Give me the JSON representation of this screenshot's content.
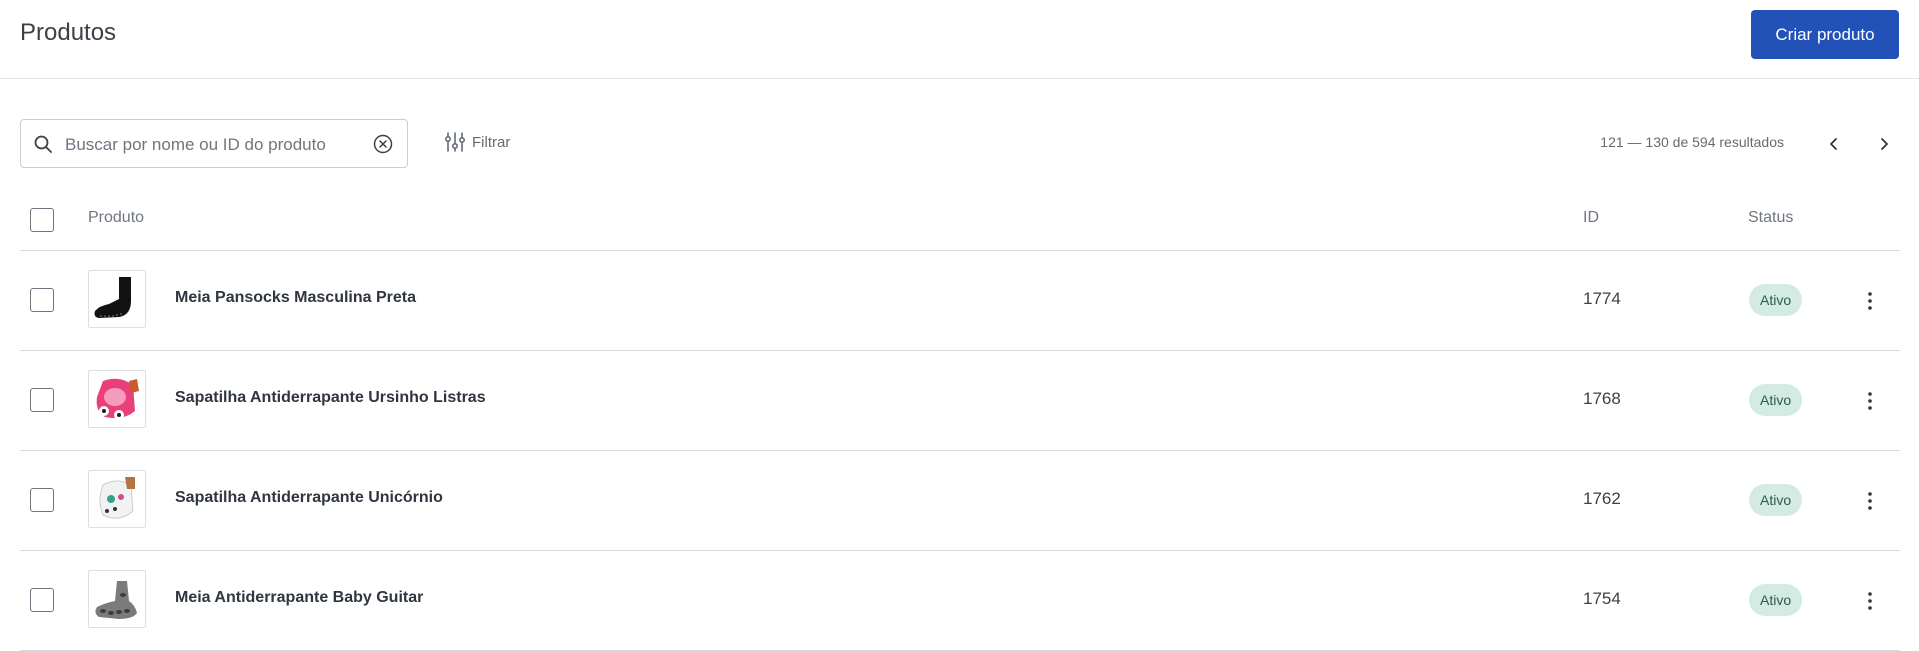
{
  "header": {
    "title": "Produtos",
    "create_label": "Criar produto"
  },
  "toolbar": {
    "search_placeholder": "Buscar por nome ou ID do produto",
    "search_value": "",
    "filter_label": "Filtrar",
    "results_text": "121 — 130 de 594 resultados"
  },
  "table": {
    "headers": {
      "product": "Produto",
      "id": "ID",
      "status": "Status"
    },
    "rows": [
      {
        "name": "Meia Pansocks Masculina Preta",
        "id": "1774",
        "status": "Ativo",
        "thumb": "black-sock"
      },
      {
        "name": "Sapatilha Antiderrapante Ursinho Listras",
        "id": "1768",
        "status": "Ativo",
        "thumb": "pink-slipper"
      },
      {
        "name": "Sapatilha Antiderrapante Unicórnio",
        "id": "1762",
        "status": "Ativo",
        "thumb": "unicorn-slipper"
      },
      {
        "name": "Meia Antiderrapante Baby Guitar",
        "id": "1754",
        "status": "Ativo",
        "thumb": "gray-sock"
      }
    ]
  },
  "colors": {
    "primary": "#2251b8",
    "badge_bg": "#d3ebe2",
    "badge_text": "#2d5b4a",
    "border": "#d6d9dd"
  },
  "icons": [
    "search-icon",
    "clear-circle-x-icon",
    "filter-sliders-icon",
    "chevron-left-icon",
    "chevron-right-icon",
    "more-vertical-icon"
  ]
}
